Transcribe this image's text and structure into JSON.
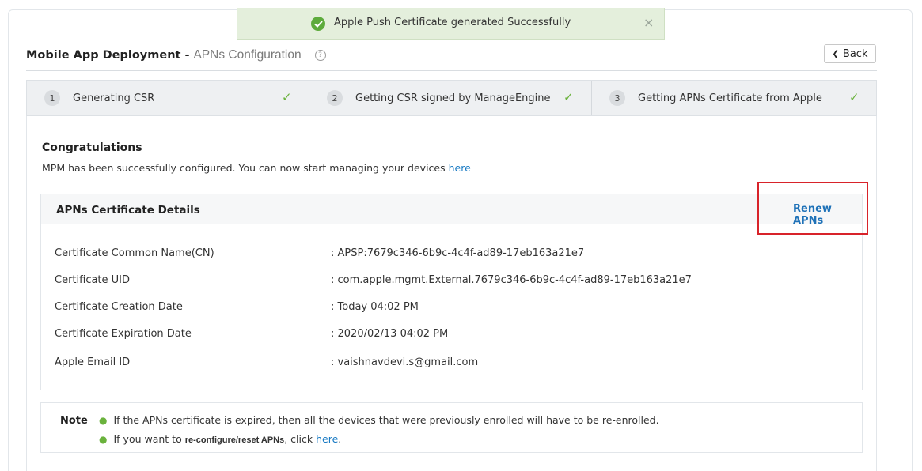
{
  "toast": {
    "message": "Apple Push Certificate generated Successfully",
    "close": "×"
  },
  "header": {
    "title": "Mobile App Deployment -",
    "subtitle": "APNs Configuration",
    "help": "?",
    "back_label": "Back"
  },
  "steps": [
    {
      "num": "1",
      "label": "Generating CSR"
    },
    {
      "num": "2",
      "label": "Getting CSR signed by ManageEngine"
    },
    {
      "num": "3",
      "label": "Getting APNs Certificate from Apple"
    }
  ],
  "congrats": {
    "title": "Congratulations",
    "text": "MPM has been successfully configured. You can now start managing your devices",
    "link": "here"
  },
  "cert": {
    "title": "APNs Certificate Details",
    "renew_label": "Renew APNs",
    "rows": [
      {
        "label": "Certificate Common Name(CN)",
        "value": ": APSP:7679c346-6b9c-4c4f-ad89-17eb163a21e7"
      },
      {
        "label": "Certificate UID",
        "value": ": com.apple.mgmt.External.7679c346-6b9c-4c4f-ad89-17eb163a21e7"
      },
      {
        "label": "Certificate Creation Date",
        "value": ": Today 04:02 PM"
      },
      {
        "label": "Certificate Expiration Date",
        "value": ": 2020/02/13 04:02 PM"
      },
      {
        "label": "Apple Email ID",
        "value": ": vaishnavdevi.s@gmail.com"
      }
    ]
  },
  "note": {
    "label": "Note",
    "line1": "If the APNs certificate is expired, then all the devices that were previously enrolled will have to be re-enrolled.",
    "line2_pre": "If you want to",
    "line2_bold": "re-configure/reset APNs",
    "line2_mid": ", click",
    "line2_link": "here",
    "line2_end": "."
  },
  "colors": {
    "accent": "#1a7bc4",
    "success": "#6ab23c",
    "highlight": "#d8232a"
  }
}
